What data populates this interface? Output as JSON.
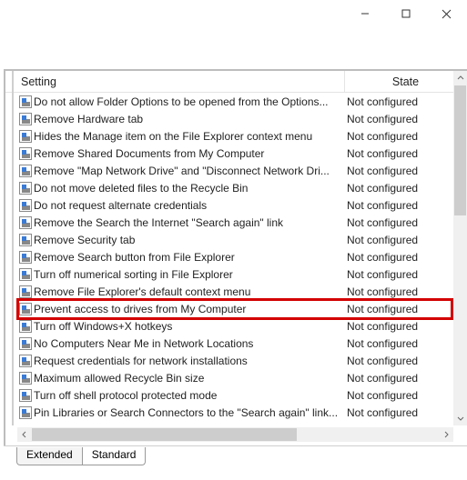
{
  "titlebar": {
    "min": "minimize-icon",
    "max": "maximize-icon",
    "close": "close-icon"
  },
  "columns": {
    "setting": "Setting",
    "state": "State"
  },
  "state_default": "Not configured",
  "items": [
    {
      "label": "Do not allow Folder Options to be opened from the Options...",
      "state": "Not configured"
    },
    {
      "label": "Remove Hardware tab",
      "state": "Not configured"
    },
    {
      "label": "Hides the Manage item on the File Explorer context menu",
      "state": "Not configured"
    },
    {
      "label": "Remove Shared Documents from My Computer",
      "state": "Not configured"
    },
    {
      "label": "Remove \"Map Network Drive\" and \"Disconnect Network Dri...",
      "state": "Not configured"
    },
    {
      "label": "Do not move deleted files to the Recycle Bin",
      "state": "Not configured"
    },
    {
      "label": "Do not request alternate credentials",
      "state": "Not configured"
    },
    {
      "label": "Remove the Search the Internet \"Search again\" link",
      "state": "Not configured"
    },
    {
      "label": "Remove Security tab",
      "state": "Not configured"
    },
    {
      "label": "Remove Search button from File Explorer",
      "state": "Not configured"
    },
    {
      "label": "Turn off numerical sorting in File Explorer",
      "state": "Not configured"
    },
    {
      "label": "Remove File Explorer's default context menu",
      "state": "Not configured"
    },
    {
      "label": "Prevent access to drives from My Computer",
      "state": "Not configured",
      "highlight": true
    },
    {
      "label": "Turn off Windows+X hotkeys",
      "state": "Not configured"
    },
    {
      "label": "No Computers Near Me in Network Locations",
      "state": "Not configured"
    },
    {
      "label": "Request credentials for network installations",
      "state": "Not configured"
    },
    {
      "label": "Maximum allowed Recycle Bin size",
      "state": "Not configured"
    },
    {
      "label": "Turn off shell protocol protected mode",
      "state": "Not configured"
    },
    {
      "label": "Pin Libraries or Search Connectors to the \"Search again\" link...",
      "state": "Not configured"
    }
  ],
  "tabs": {
    "extended": "Extended",
    "standard": "Standard",
    "active": "standard"
  }
}
